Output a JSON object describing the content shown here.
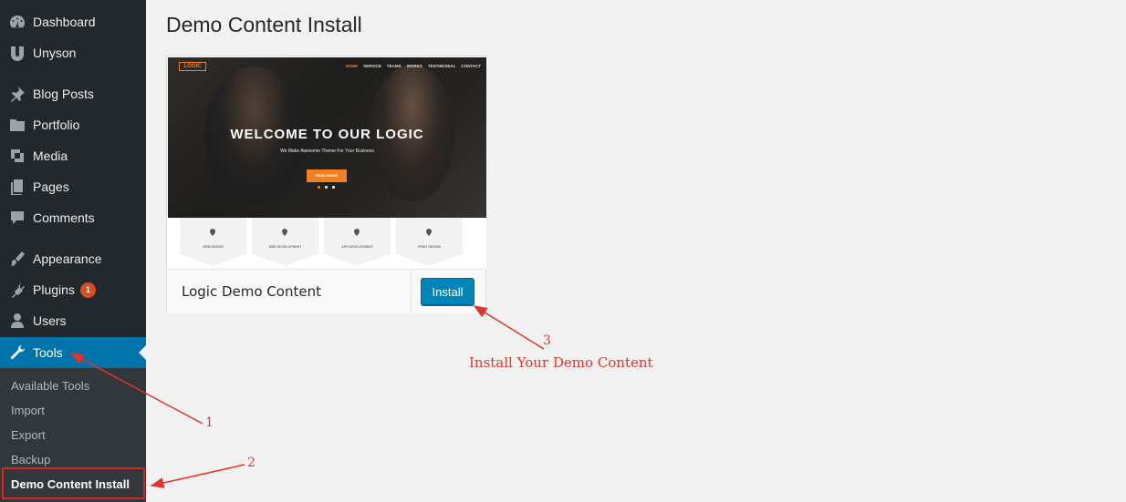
{
  "sidebar": {
    "items": [
      {
        "label": "Dashboard",
        "icon": "dashboard-icon"
      },
      {
        "label": "Unyson",
        "icon": "unyson-icon"
      },
      {
        "label": "Blog Posts",
        "icon": "pin-icon"
      },
      {
        "label": "Portfolio",
        "icon": "folder-icon"
      },
      {
        "label": "Media",
        "icon": "media-icon"
      },
      {
        "label": "Pages",
        "icon": "pages-icon"
      },
      {
        "label": "Comments",
        "icon": "comment-icon"
      },
      {
        "label": "Appearance",
        "icon": "brush-icon"
      },
      {
        "label": "Plugins",
        "icon": "plug-icon",
        "badge": "1"
      },
      {
        "label": "Users",
        "icon": "user-icon"
      },
      {
        "label": "Tools",
        "icon": "wrench-icon",
        "active": true
      }
    ],
    "submenu": [
      "Available Tools",
      "Import",
      "Export",
      "Backup",
      "Demo Content Install"
    ]
  },
  "main": {
    "title": "Demo Content Install",
    "card": {
      "name": "Logic Demo Content",
      "install_label": "Install",
      "preview": {
        "logo": "LOGIC",
        "nav": [
          "HOME",
          "SERVICE",
          "TEAMS",
          "WORKS",
          "TESTIMONIAL",
          "CONTACT"
        ],
        "hero_title": "WELCOME TO OUR LOGIC",
        "hero_sub": "We Make Awesome Theme For Your Business",
        "hero_button": "READ MORE",
        "services": [
          "WEB DESIGN",
          "WEB DEVELOPMENT",
          "APP DEVELOPMENT",
          "PRINT DESIGN"
        ]
      }
    }
  },
  "annotations": {
    "step1": "1",
    "step2": "2",
    "step3": "3",
    "step3_caption": "Install Your Demo Content"
  },
  "colors": {
    "sidebar_bg": "#23282d",
    "active_bg": "#0073aa",
    "button_bg": "#0085ba",
    "annotation": "#e0362a",
    "accent": "#f47f20"
  }
}
